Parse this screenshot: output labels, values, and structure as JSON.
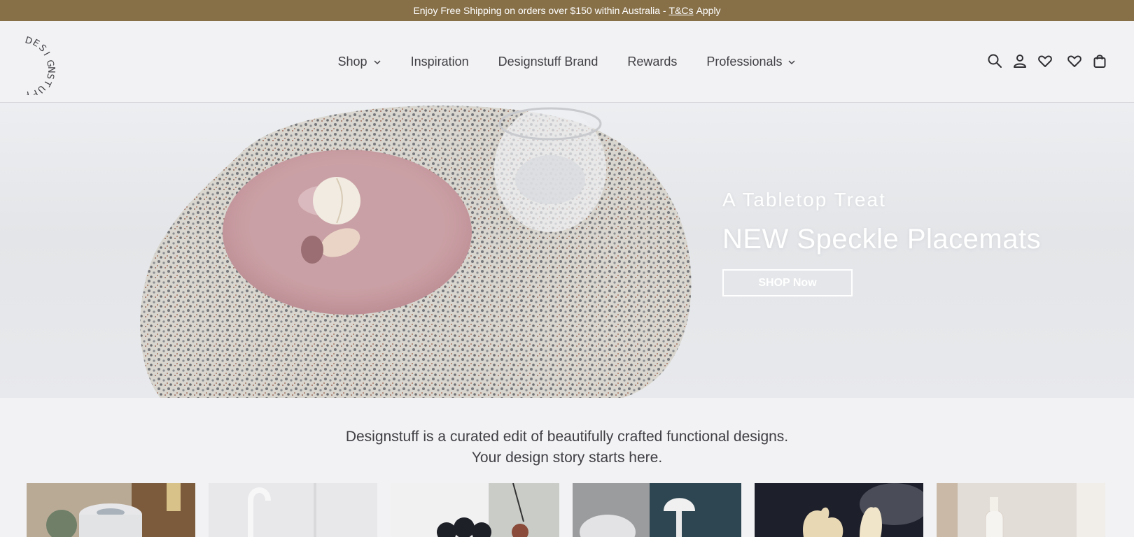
{
  "announcement": {
    "text_before": "Enjoy Free Shipping on orders over $150 within Australia -",
    "link": "T&Cs",
    "text_after": "Apply"
  },
  "brand": {
    "logo_text": "DESIGNSTUFF"
  },
  "nav": [
    {
      "label": "Shop",
      "has_dropdown": true
    },
    {
      "label": "Inspiration",
      "has_dropdown": false
    },
    {
      "label": "Designstuff Brand",
      "has_dropdown": false
    },
    {
      "label": "Rewards",
      "has_dropdown": false
    },
    {
      "label": "Professionals",
      "has_dropdown": true
    }
  ],
  "header_icons": [
    "search-icon",
    "account-icon",
    "wishlist-icon",
    "wishlist-icon",
    "cart-icon"
  ],
  "hero": {
    "kicker": "A Tabletop Treat",
    "title": "NEW Speckle Placemats",
    "button": "SHOP Now"
  },
  "intro": {
    "line1": "Designstuff is a curated edit of beautifully crafted functional designs.",
    "line2": "Your design story starts here."
  },
  "colors": {
    "announcement_bg": "#877048",
    "page_bg": "#f2f2f4",
    "text": "#3a3a3e"
  }
}
